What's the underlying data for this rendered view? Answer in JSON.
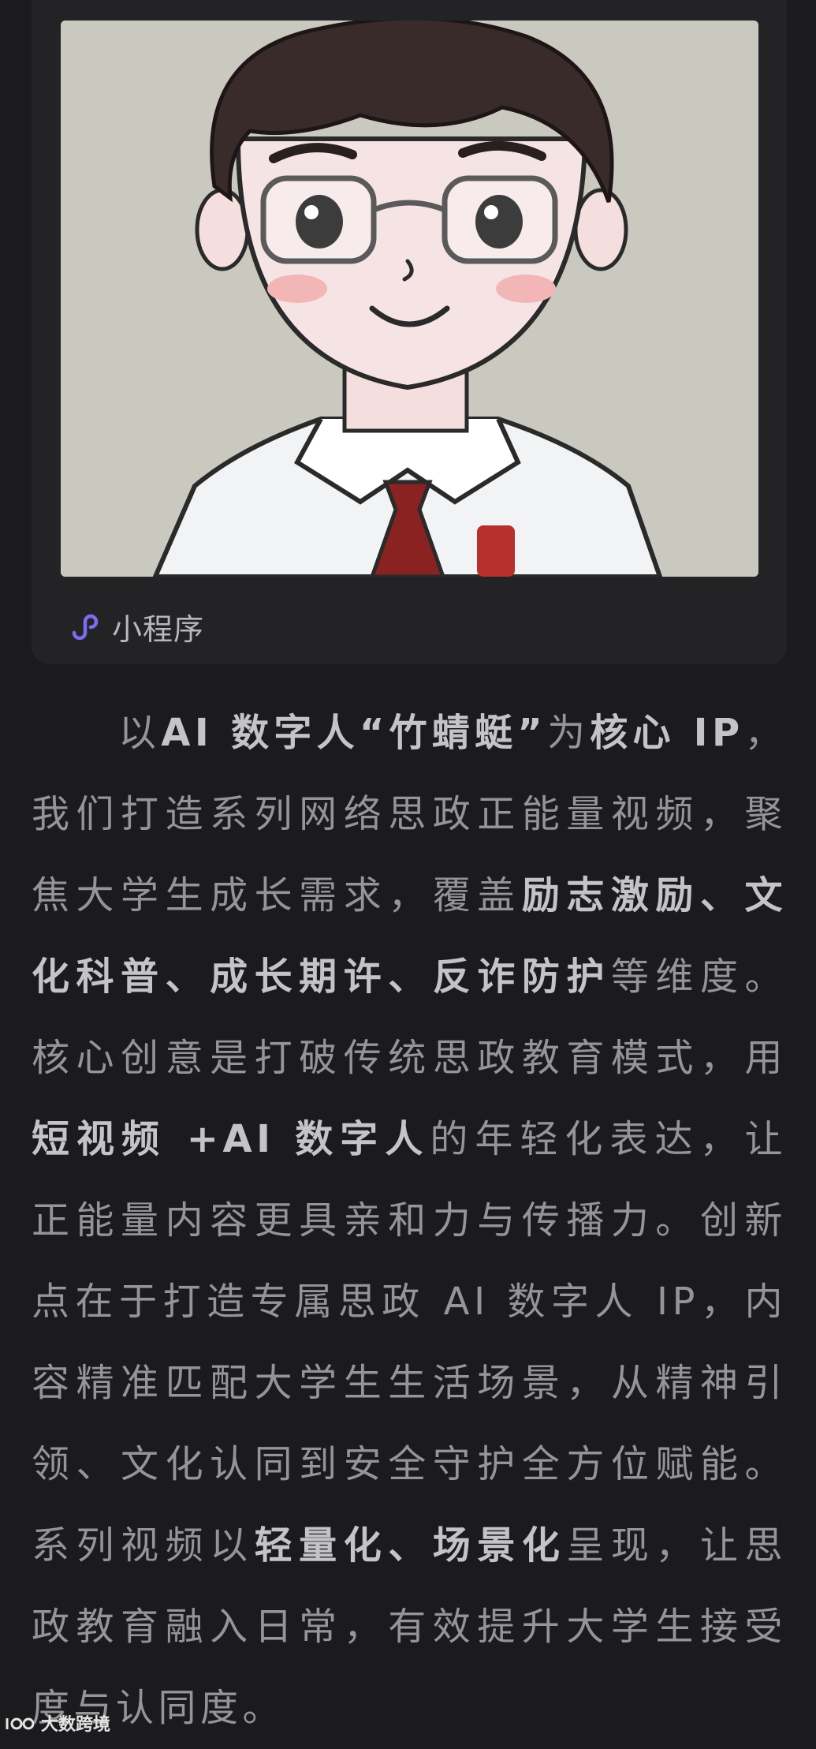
{
  "card": {
    "mini_program_label": "小程序",
    "colors": {
      "background": "#232325",
      "image_bg": "#c9c9c0"
    }
  },
  "article": {
    "segments": [
      {
        "text": "以",
        "bold": false
      },
      {
        "text": "AI 数字人“竹蜻蜓”",
        "bold": true
      },
      {
        "text": "为",
        "bold": false
      },
      {
        "text": "核心 IP",
        "bold": true
      },
      {
        "text": "，我们打造系列网络思政正能量视频，聚焦大学生成长需求，覆盖",
        "bold": false
      },
      {
        "text": "励志激励、文化科普、成长期许、反诈防护",
        "bold": true
      },
      {
        "text": "等维度。核心创意是打破传统思政教育模式，用",
        "bold": false
      },
      {
        "text": "短视频 +AI 数字人",
        "bold": true
      },
      {
        "text": "的年轻化表达，让正能量内容更具亲和力与传播力。创新点在于打造专属思政 AI 数字人 IP，内容精准匹配大学生生活场景，从精神引领、文化认同到安全守护全方位赋能。系列视频以",
        "bold": false
      },
      {
        "text": "轻量化、场景化",
        "bold": true
      },
      {
        "text": "呈现，让思政教育融入日常，有效提升大学生接受度与认同度。",
        "bold": false
      }
    ]
  },
  "watermark": {
    "text": "大数跨境",
    "icon": "bigdata-logo-icon"
  },
  "icons": {
    "mini_program": "mini-program-link-icon"
  },
  "colors": {
    "page_bg": "#1b1b1d",
    "body_text": "#959597",
    "bold_text": "#c4c4c6",
    "accent": "#7b6cf0"
  }
}
